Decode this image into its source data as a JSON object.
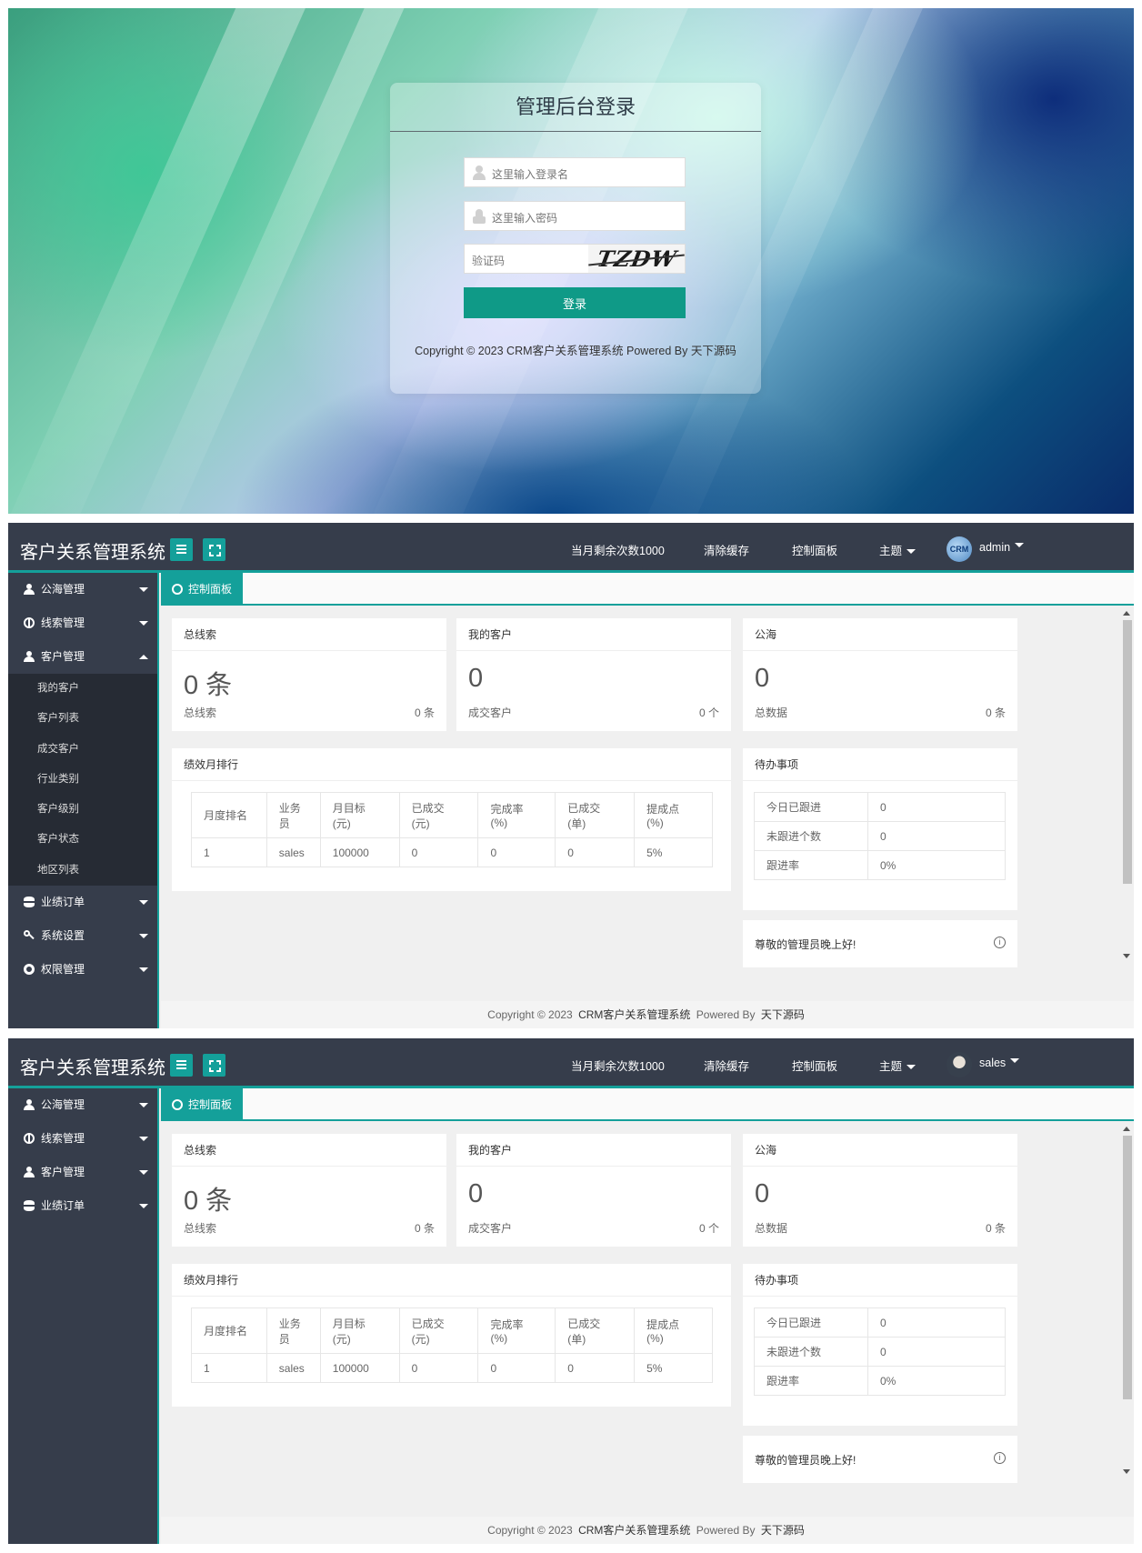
{
  "login": {
    "title": "管理后台登录",
    "username_placeholder": "这里输入登录名",
    "password_placeholder": "这里输入密码",
    "captcha_placeholder": "验证码",
    "captcha_text": "TZDW",
    "submit_label": "登录",
    "copyright": "Copyright © 2023 CRM客户关系管理系统 Powered By 天下源码"
  },
  "panels": [
    {
      "brand": "客户关系管理系统",
      "nav": {
        "remaining": "当月剩余次数1000",
        "clear_cache": "清除缓存",
        "dashboard": "控制面板",
        "theme": "主题",
        "user": "admin",
        "avatar_icon": "crm-logo-icon"
      },
      "sidebar": [
        {
          "label": "公海管理",
          "icon": "person-icon",
          "expanded": false
        },
        {
          "label": "线索管理",
          "icon": "globe-icon",
          "expanded": false
        },
        {
          "label": "客户管理",
          "icon": "user-icon",
          "expanded": true,
          "children": [
            "我的客户",
            "客户列表",
            "成交客户",
            "行业类别",
            "客户级别",
            "客户状态",
            "地区列表"
          ]
        },
        {
          "label": "业绩订单",
          "icon": "database-icon",
          "expanded": false
        },
        {
          "label": "系统设置",
          "icon": "key-icon",
          "expanded": false
        },
        {
          "label": "权限管理",
          "icon": "lifebuoy-icon",
          "expanded": false
        }
      ]
    },
    {
      "brand": "客户关系管理系统",
      "nav": {
        "remaining": "当月剩余次数1000",
        "clear_cache": "清除缓存",
        "dashboard": "控制面板",
        "theme": "主题",
        "user": "sales",
        "avatar_icon": "user-avatar-icon"
      },
      "sidebar": [
        {
          "label": "公海管理",
          "icon": "person-icon",
          "expanded": false
        },
        {
          "label": "线索管理",
          "icon": "globe-icon",
          "expanded": false
        },
        {
          "label": "客户管理",
          "icon": "user-icon",
          "expanded": false
        },
        {
          "label": "业绩订单",
          "icon": "database-icon",
          "expanded": false
        }
      ]
    }
  ],
  "dashboard": {
    "tab": "控制面板",
    "stats": [
      {
        "title": "总线索",
        "big": "0 条",
        "label": "总线索",
        "value": "0 条"
      },
      {
        "title": "我的客户",
        "big": "0",
        "label": "成交客户",
        "value": "0 个"
      },
      {
        "title": "公海",
        "big": "0",
        "label": "总数据",
        "value": "0 条"
      }
    ],
    "ranking": {
      "title": "绩效月排行",
      "headers": [
        "月度排名",
        "业务员",
        "月目标(元)",
        "已成交(元)",
        "完成率(%)",
        "已成交(单)",
        "提成点(%)"
      ],
      "rows": [
        [
          "1",
          "sales",
          "100000",
          "0",
          "0",
          "0",
          "5%"
        ]
      ]
    },
    "todo": {
      "title": "待办事项",
      "rows": [
        [
          "今日已跟进",
          "0"
        ],
        [
          "未跟进个数",
          "0"
        ],
        [
          "跟进率",
          "0%"
        ]
      ]
    },
    "welcome": "尊敬的管理员晚上好!",
    "footer": {
      "prefix": "Copyright © 2023",
      "name": "CRM客户关系管理系统",
      "powered": "Powered By",
      "author": "天下源码"
    }
  }
}
